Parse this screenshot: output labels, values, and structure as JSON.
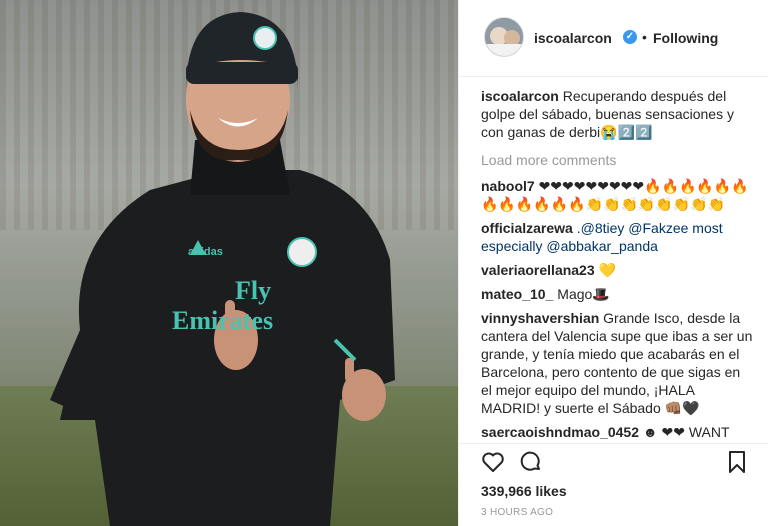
{
  "post": {
    "author": "iscoalarcon",
    "follow_separator": "•",
    "follow_status": "Following",
    "caption_user": "iscoalarcon",
    "caption_text": "Recuperando después del golpe del sábado, buenas sensaciones y con ganas de derbi😭2️⃣2️⃣",
    "load_more": "Load more comments",
    "likes": "339,966 likes",
    "time_ago": "3 HOURS AGO"
  },
  "photo": {
    "jersey_logo_text": "adidas",
    "jersey_sponsor_line1": "Fly",
    "jersey_sponsor_line2": "Emirates"
  },
  "comments": [
    {
      "user": "nabool7",
      "text": "❤❤❤❤❤❤❤❤❤🔥🔥🔥🔥🔥🔥🔥🔥🔥🔥🔥🔥👏👏👏👏👏👏👏👏"
    },
    {
      "user": "officialzarewa",
      "text": ".@8tiey @Fakzee most especially @abbakar_panda"
    },
    {
      "user": "valeriaorellana23",
      "text": "💛"
    },
    {
      "user": "mateo_10_",
      "text": "Mago🎩"
    },
    {
      "user": "vinnyshavershian",
      "text": "Grande Isco, desde la cantera del Valencia supe que ibas a ser un grande, y tenía miedo que acabarás en el Barcelona, pero contento de que sigas en el mejor equipo del mundo, ¡HALA MADRID! y suerte el Sábado 👊🏽🖤"
    },
    {
      "user": "saercaoishndmao_0452",
      "text": "☻ ❤❤ WANT"
    }
  ],
  "icons": {
    "like": "heart-outline-icon",
    "comment": "comment-bubble-icon",
    "save": "bookmark-icon",
    "verified": "verified-badge-icon"
  },
  "colors": {
    "verified": "#3897f0",
    "muted": "#999999",
    "text": "#262626"
  }
}
